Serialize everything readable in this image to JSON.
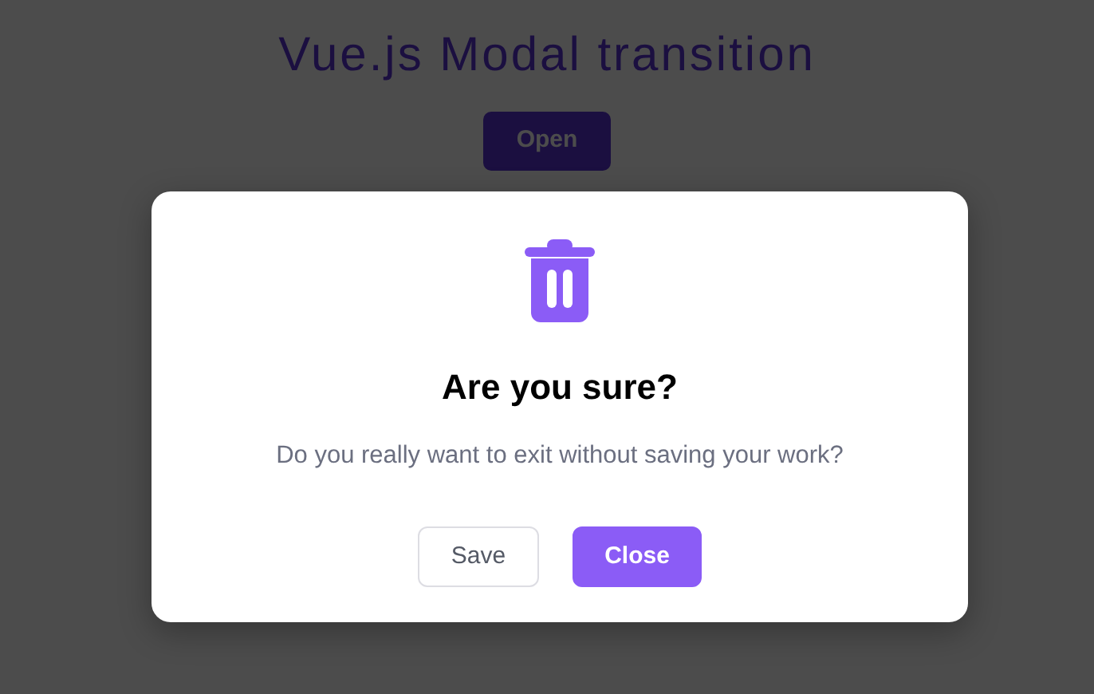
{
  "page": {
    "title": "Vue.js Modal transition",
    "open_button": "Open"
  },
  "modal": {
    "open": true,
    "heading": "Are you sure?",
    "message": "Do you really want to exit without saving your work?",
    "buttons": [
      {
        "label": "Save",
        "kind": "secondary"
      },
      {
        "label": "Close",
        "kind": "primary"
      }
    ]
  }
}
